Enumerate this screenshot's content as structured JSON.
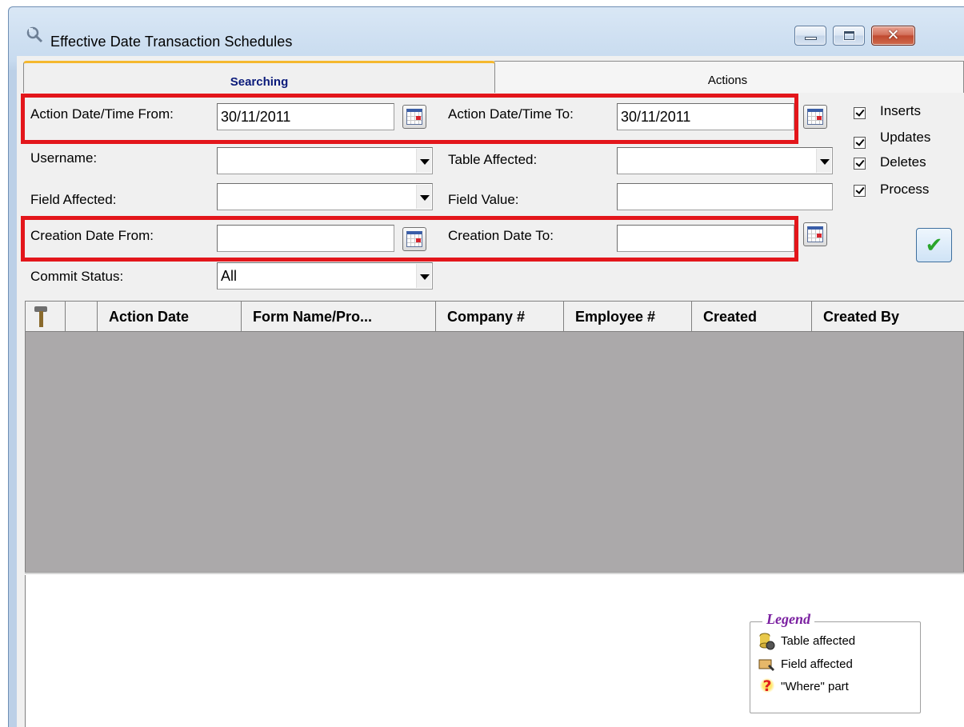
{
  "window": {
    "title": "Effective Date Transaction Schedules",
    "close_glyph": "✕",
    "icon": "app-wrench-icon"
  },
  "tabs": [
    {
      "label": "Searching",
      "active": true
    },
    {
      "label": "Actions",
      "active": false
    }
  ],
  "form": {
    "action_from_label": "Action Date/Time From:",
    "action_from_value": "30/11/2011",
    "action_to_label": "Action Date/Time To:",
    "action_to_value": "30/11/2011",
    "username_label": "Username:",
    "username_value": "",
    "table_affected_label": "Table Affected:",
    "table_affected_value": "",
    "field_affected_label": "Field Affected:",
    "field_affected_value": "",
    "field_value_label": "Field Value:",
    "field_value_value": "",
    "creation_from_label": "Creation Date From:",
    "creation_from_value": "",
    "creation_to_label": "Creation Date To:",
    "creation_to_value": "",
    "commit_status_label": "Commit Status:",
    "commit_status_value": "All"
  },
  "checkboxes": [
    {
      "label": "Inserts",
      "checked": true
    },
    {
      "label": "Updates",
      "checked": true
    },
    {
      "label": "Deletes",
      "checked": true
    },
    {
      "label": "Process",
      "checked": true
    }
  ],
  "apply_button_glyph": "✔",
  "grid": {
    "columns": [
      "",
      "",
      "Action Date",
      "Form Name/Pro...",
      "Company #",
      "Employee #",
      "Created",
      "Created By"
    ],
    "rows": []
  },
  "legend": {
    "title": "Legend",
    "items": [
      {
        "label": "Table affected",
        "icon": "table-affected-icon"
      },
      {
        "label": "Field affected",
        "icon": "field-affected-icon"
      },
      {
        "label": "\"Where\" part",
        "icon": "question-mark-icon",
        "glyph": "?"
      }
    ]
  },
  "colors": {
    "highlight_red": "#e3161b",
    "active_tab_text": "#0a1a7a",
    "legend_title": "#7a1fa0",
    "grid_background": "#aba9aa"
  }
}
